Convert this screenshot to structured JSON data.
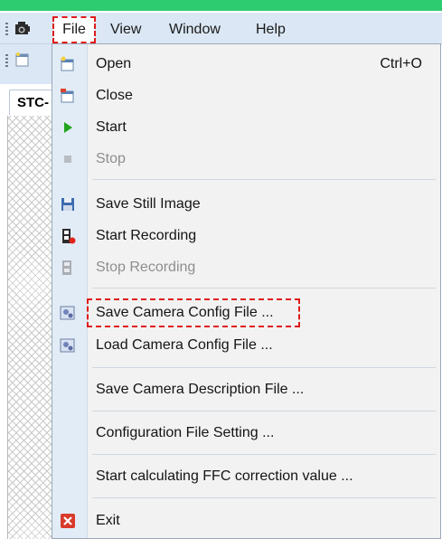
{
  "menubar": {
    "file": "File",
    "view": "View",
    "window": "Window",
    "help": "Help"
  },
  "tab": {
    "label": "STC-"
  },
  "file_menu": {
    "open": {
      "label": "Open",
      "shortcut": "Ctrl+O"
    },
    "close": {
      "label": "Close"
    },
    "start": {
      "label": "Start"
    },
    "stop": {
      "label": "Stop"
    },
    "save_still": {
      "label": "Save Still Image"
    },
    "start_recording": {
      "label": "Start Recording"
    },
    "stop_recording": {
      "label": "Stop Recording"
    },
    "save_config": {
      "label": "Save Camera Config File ..."
    },
    "load_config": {
      "label": "Load Camera Config File ..."
    },
    "save_description": {
      "label": "Save Camera Description File ..."
    },
    "config_setting": {
      "label": "Configuration File Setting ..."
    },
    "ffc": {
      "label": "Start calculating FFC correction value ..."
    },
    "exit": {
      "label": "Exit"
    }
  },
  "colors": {
    "highlight_outline": "#e01b1b",
    "menubar_bg": "#dbe7f5",
    "gutter_bg": "#e2ecf7",
    "start_play": "#22a41f",
    "exit_red": "#d93a2b"
  }
}
